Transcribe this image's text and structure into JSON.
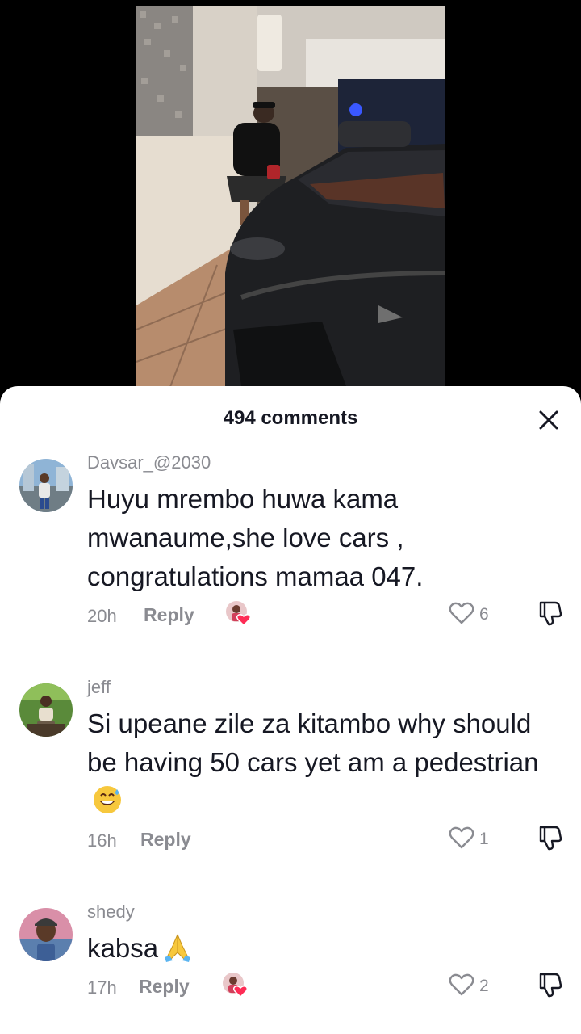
{
  "sheet": {
    "comment_count": "494 comments"
  },
  "comments": [
    {
      "username": "Davsar_@2030",
      "text": "Huyu mrembo huwa kama mwanaume,she love cars , congratulations mamaa 047.",
      "time": "20h",
      "reply_label": "Reply",
      "likes": "6",
      "liked_by_creator": true
    },
    {
      "username": "jeff",
      "text": "Si upeane zile za kitambo why should be having 50 cars yet am a pedestrian",
      "emoji": "grinning-sweat-emoji",
      "time": "16h",
      "reply_label": "Reply",
      "likes": "1",
      "liked_by_creator": false
    },
    {
      "username": "shedy",
      "text": "kabsa",
      "emoji": "folded-hands-emoji",
      "time": "17h",
      "reply_label": "Reply",
      "likes": "2",
      "liked_by_creator": true
    }
  ],
  "colors": {
    "text": "#161823",
    "secondary": "#8a8b91",
    "like_heart": "#fe2c55"
  }
}
